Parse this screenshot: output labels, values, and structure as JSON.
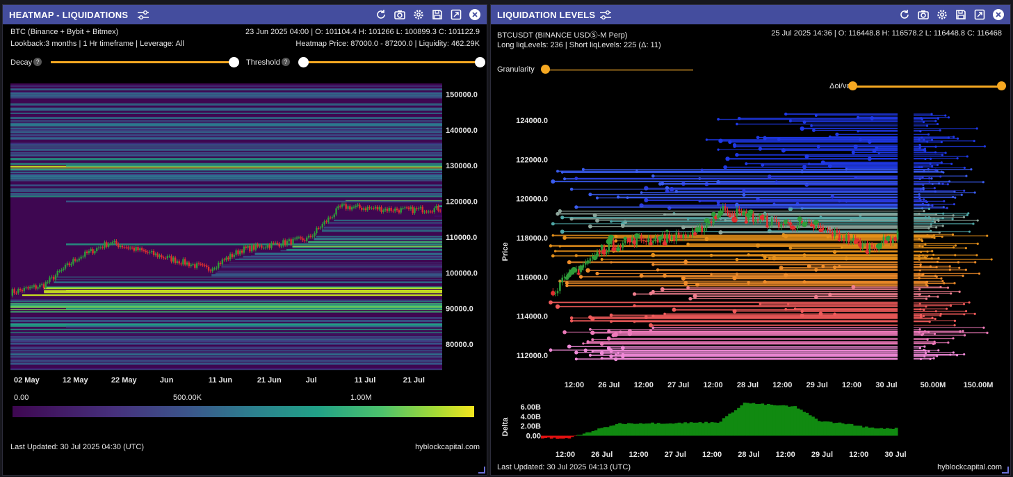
{
  "left": {
    "title": "HEATMAP - LIQUIDATIONS",
    "symbol": "BTC (Binance + Bybit + Bitmex)",
    "ohlc": "23 Jun 2025 04:00 | O: 101104.4 H: 101266 L: 100899.3 C: 101122.9",
    "info": "Lookback:3 months | 1 Hr timeframe | Leverage: All",
    "heatmap_info": "Heatmap Price: 87000.0 - 87200.0 | Liquidity: 462.29K",
    "decay_label": "Decay",
    "threshold_label": "Threshold",
    "help": "?",
    "y_ticks": [
      "150000.0",
      "140000.0",
      "130000.0",
      "120000.0",
      "110000.0",
      "100000.0",
      "90000.0",
      "80000.0"
    ],
    "x_ticks": [
      "02 May",
      "12 May",
      "22 May",
      "Jun",
      "11 Jun",
      "21 Jun",
      "Jul",
      "11 Jul",
      "21 Jul"
    ],
    "colorbar_labels": [
      "0.00",
      "500.00K",
      "1.00M"
    ],
    "last_updated": "Last Updated: 30 Jul 2025 04:30 (UTC)",
    "brand": "hyblockcapital.com"
  },
  "right": {
    "title": "LIQUIDATION LEVELS",
    "symbol": "BTCUSDT (BINANCE USDⓈ-M Perp)",
    "ohlc": "25 Jul 2025 14:36 | O: 116448.8 H: 116578.2 L: 116448.8 C: 116468",
    "levels": "Long liqLevels: 236 | Short liqLevels: 225 (Δ: 11)",
    "granularity_label": "Granularity",
    "doi_label": "Δoi/vol",
    "y_label": "Price",
    "y_ticks": [
      "124000.0",
      "122000.0",
      "120000.0",
      "118000.0",
      "116000.0",
      "114000.0",
      "112000.0"
    ],
    "x_ticks": [
      "12:00",
      "26 Jul",
      "12:00",
      "27 Jul",
      "12:00",
      "28 Jul",
      "12:00",
      "29 Jul",
      "12:00",
      "30 Jul"
    ],
    "side_ticks": [
      "50.00M",
      "150.00M"
    ],
    "delta_label": "Delta",
    "delta_ticks": [
      "6.00B",
      "4.00B",
      "2.00B",
      "0.00"
    ],
    "last_updated": "Last Updated: 30 Jul 2025 04:13 (UTC)",
    "brand": "hyblockcapital.com"
  },
  "colors": {
    "header": "#444d9e",
    "accent": "#f6a821",
    "long": "#2e9c3a",
    "short": "#e03030"
  },
  "chart_data": [
    {
      "type": "heatmap",
      "title": "HEATMAP - LIQUIDATIONS",
      "x": [
        "02 May",
        "12 May",
        "22 May",
        "Jun",
        "11 Jun",
        "21 Jun",
        "Jul",
        "11 Jul",
        "21 Jul"
      ],
      "ylim": [
        73000,
        153000
      ],
      "price_close": [
        94500,
        96500,
        104000,
        108500,
        106000,
        103500,
        101000,
        106500,
        108000,
        109500,
        118500,
        118000,
        117500,
        118000
      ],
      "liquidity_bands": [
        {
          "price": 130000,
          "value": 700000
        },
        {
          "price": 120000,
          "value": 600000
        },
        {
          "price": 108000,
          "value": 700000
        },
        {
          "price": 95000,
          "value": 1000000
        },
        {
          "price": 90000,
          "value": 700000
        },
        {
          "price": 85000,
          "value": 500000
        }
      ],
      "colorbar": {
        "min": 0,
        "max": 1200000
      }
    },
    {
      "type": "scatter",
      "title": "LIQUIDATION LEVELS",
      "ylabel": "Price",
      "ylim": [
        111000,
        124500
      ],
      "x": [
        "12:00",
        "26 Jul",
        "12:00",
        "27 Jul",
        "12:00",
        "28 Jul",
        "12:00",
        "29 Jul",
        "12:00",
        "30 Jul"
      ],
      "price_close": [
        115200,
        116500,
        117600,
        117900,
        118000,
        118200,
        119500,
        119000,
        118700,
        118600,
        118100,
        117500,
        118100
      ],
      "delta": {
        "ylabel": "Delta",
        "values": [
          -0.5,
          -0.6,
          1.0,
          2.5,
          2.6,
          2.6,
          2.7,
          2.8,
          6.8,
          6.4,
          6.0,
          3.0,
          2.5,
          1.6,
          1.5
        ],
        "unit": "B"
      },
      "side_bars_xticks": [
        "50.00M",
        "150.00M"
      ]
    }
  ]
}
